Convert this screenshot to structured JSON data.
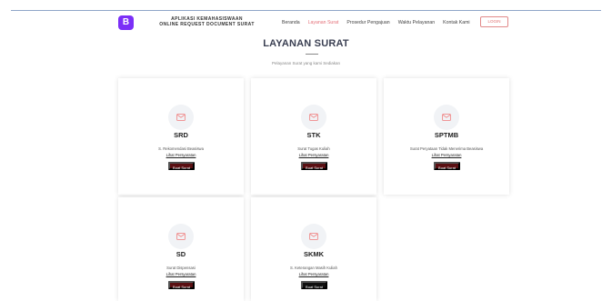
{
  "navbar": {
    "brand_letter": "B",
    "brand_line1": "APLIKASI KEMAHASISWAAN",
    "brand_line2": "ONLINE REQUEST DOCUMENT SURAT",
    "links": [
      "Beranda",
      "Layanan Surat",
      "Prosedur Pengajuan",
      "Waktu Pelayanan",
      "Kontak Kami"
    ],
    "active_link": "Layanan Surat",
    "login_label": "LOGIN"
  },
  "section": {
    "title": "LAYANAN SURAT",
    "subtitle": "Pelayanan Surat yang kami Sediakan"
  },
  "cards": [
    {
      "code": "SRD",
      "desc": "S. Rekomendasi Beasiswa",
      "link": "Lihat Persyaratan",
      "button": "Buat Surat"
    },
    {
      "code": "STK",
      "desc": "Surat Tugas Kuliah",
      "link": "Lihat Persyaratan",
      "button": "Buat Surat"
    },
    {
      "code": "SPTMB",
      "desc": "Surat Peryataan Tidak Menerima Beasiswa",
      "link": "Lihat Persyaratan",
      "button": "Buat Surat"
    },
    {
      "code": "SD",
      "desc": "Surat Dispensasi",
      "link": "Lihat Persyaratan",
      "button": "Buat Surat"
    },
    {
      "code": "SKMK",
      "desc": "S. Keterangan Masih Kuliah",
      "link": "Lihat Persyaratan",
      "button": "Buat Surat"
    }
  ],
  "colors": {
    "brand": "#7b2ff7",
    "accent": "#e4717a",
    "button": "#5a0f12",
    "icon": "#f08a8a"
  }
}
